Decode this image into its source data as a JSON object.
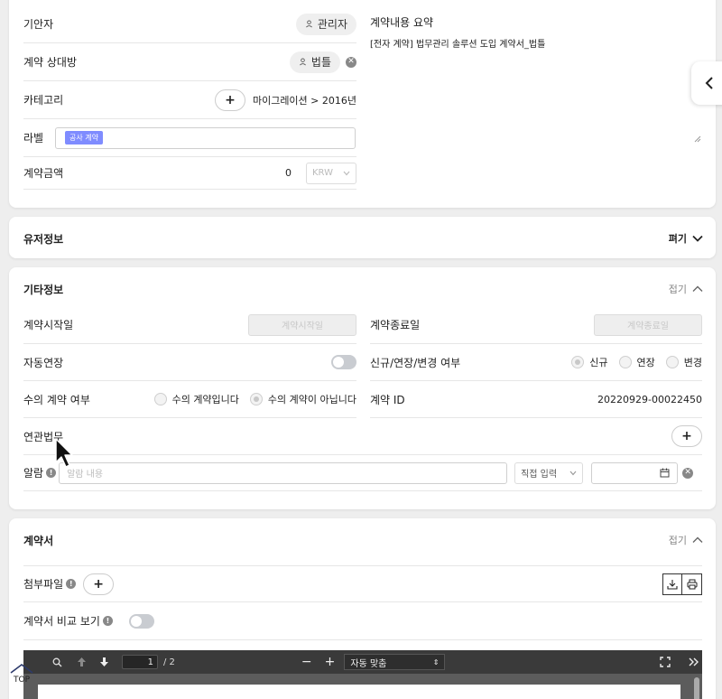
{
  "basic": {
    "drafter_label": "기안자",
    "drafter_value": "관리자",
    "party_label": "계약 상대방",
    "party_value": "법틀",
    "category_label": "카테고리",
    "category_plus": "+",
    "category_path": "마이그레이션 >  2016년",
    "label_label": "라벨",
    "label_tag": "공사 계약",
    "amount_label": "계약금액",
    "amount_value": "0",
    "currency": "KRW",
    "summary_label": "계약내용 요약",
    "summary_value": "[전자 계약] 법무관리 솔루션 도입 계약서_법틀"
  },
  "user_info": {
    "title": "유저정보",
    "toggle": "펴기"
  },
  "etc_info": {
    "title": "기타정보",
    "toggle": "접기",
    "start_label": "계약시작일",
    "start_placeholder": "계약시작일",
    "end_label": "계약종료일",
    "end_placeholder": "계약종료일",
    "auto_renew_label": "자동연장",
    "type_label": "신규/연장/변경 여부",
    "type_options": [
      "신규",
      "연장",
      "변경"
    ],
    "private_label": "수의 계약 여부",
    "private_options": [
      "수의 계약입니다",
      "수의 계약이 아닙니다"
    ],
    "contract_id_label": "계약 ID",
    "contract_id_value": "20220929-00022450",
    "related_label": "연관법무",
    "related_plus": "+",
    "alarm_label": "알람",
    "alarm_placeholder": "알람 내용",
    "alarm_select": "직접 입력"
  },
  "contract_doc": {
    "title": "계약서",
    "toggle": "접기",
    "attach_label": "첨부파일",
    "attach_plus": "+",
    "compare_label": "계약서 비교 보기",
    "page_current": "1",
    "page_total": "/ 2",
    "zoom_select": "자동 맞춤",
    "top_label": "TOP"
  }
}
